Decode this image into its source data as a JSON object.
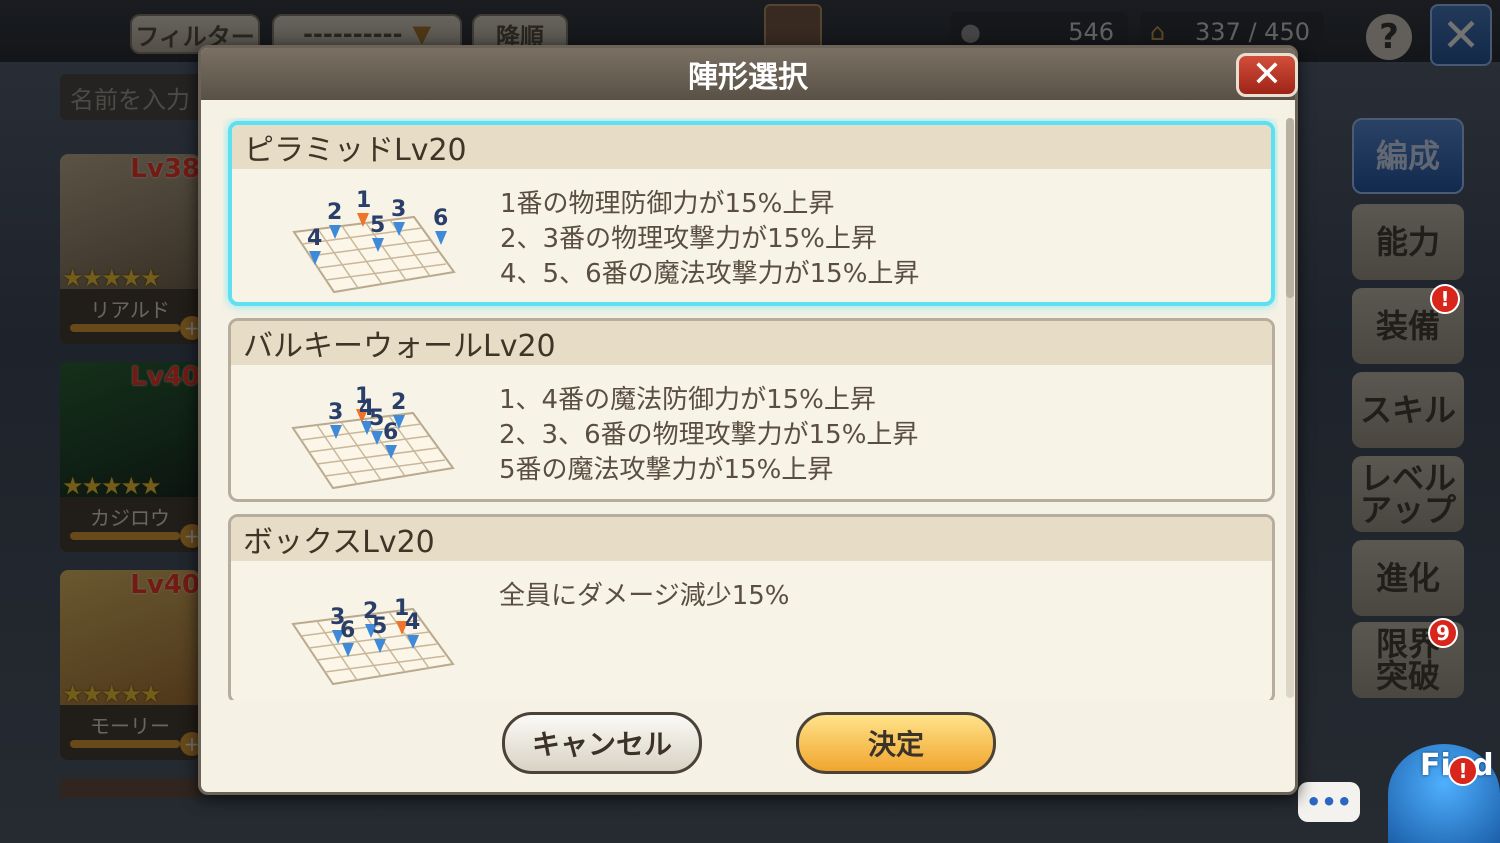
{
  "topbar": {
    "filter_label": "フィルター",
    "dropdown_value": "----------",
    "sort_label": "降順",
    "stat1_value": "546",
    "stat2_value": "337 / 450",
    "help_label": "?",
    "close_label": "✕"
  },
  "search": {
    "placeholder": "名前を入力"
  },
  "cards": [
    {
      "level": "Lv38",
      "name": "リアルド",
      "stars": "★★★★★"
    },
    {
      "level": "Lv40",
      "name": "カジロウ",
      "stars": "★★★★★"
    },
    {
      "level": "Lv40",
      "name": "モーリー",
      "stars": "★★★★★"
    }
  ],
  "sidetabs": [
    {
      "label": "編成"
    },
    {
      "label": "能力"
    },
    {
      "label": "装備",
      "badge": "!"
    },
    {
      "label": "スキル"
    },
    {
      "label": "レベルアップ",
      "label_lines": [
        "レベル",
        "アップ"
      ]
    },
    {
      "label": "進化"
    },
    {
      "label": "限界突破",
      "label_lines": [
        "限界",
        "突破"
      ],
      "badge": "9"
    }
  ],
  "modal": {
    "title": "陣形選択",
    "close_label": "✕",
    "formations": [
      {
        "name": "ピラミッドLv20",
        "selected": true,
        "effects": [
          "1番の物理防御力が15%上昇",
          "2、3番の物理攻撃力が15%上昇",
          "4、5、6番の魔法攻撃力が15%上昇"
        ],
        "markers": [
          "1",
          "2",
          "3",
          "4",
          "5",
          "6"
        ]
      },
      {
        "name": "バルキーウォールLv20",
        "selected": false,
        "effects": [
          "1、4番の魔法防御力が15%上昇",
          "2、3、6番の物理攻撃力が15%上昇",
          "5番の魔法攻撃力が15%上昇"
        ],
        "markers": [
          "1",
          "2",
          "3",
          "4",
          "5",
          "6"
        ]
      },
      {
        "name": "ボックスLv20",
        "selected": false,
        "effects": [
          "全員にダメージ減少15%"
        ],
        "markers": [
          "1",
          "2",
          "3",
          "4",
          "5",
          "6"
        ]
      }
    ],
    "cancel_label": "キャンセル",
    "ok_label": "決定"
  },
  "chat": {
    "label": "•••"
  },
  "mascot": {
    "label": "Find",
    "badge": "!"
  }
}
